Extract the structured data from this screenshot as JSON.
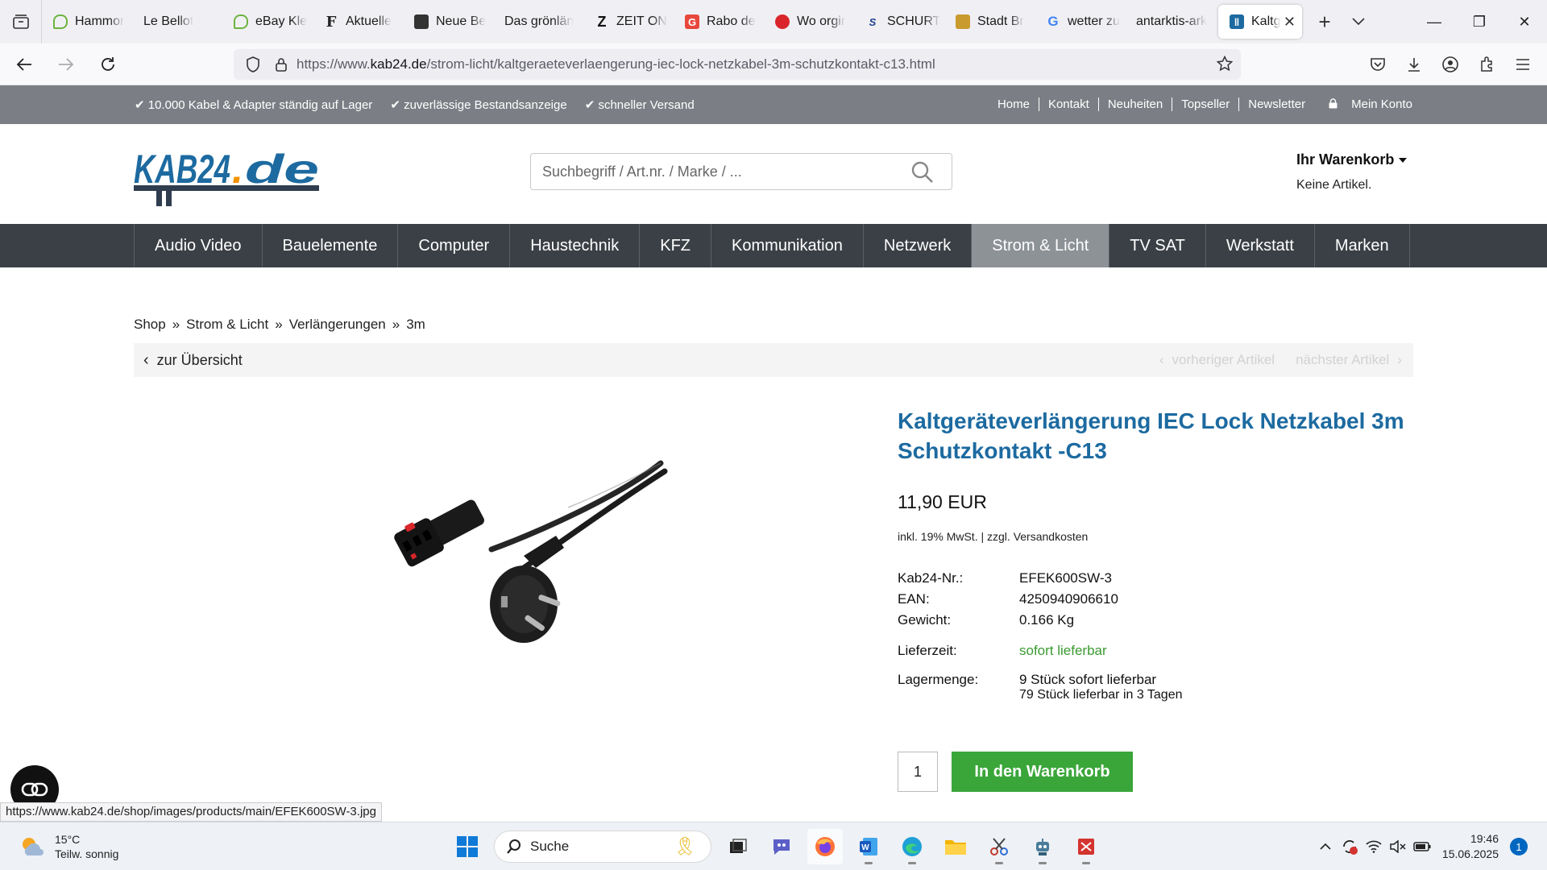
{
  "browser": {
    "tabs": [
      {
        "label": "Hammor",
        "icon": "ebay-kleinanzeigen-icon",
        "color": "#6db33f"
      },
      {
        "label": "Le Bellot",
        "icon": "blank-page-icon",
        "color": "#f0f0f4"
      },
      {
        "label": "eBay Kle",
        "icon": "ebay-kleinanzeigen-icon",
        "color": "#6db33f"
      },
      {
        "label": "Aktuelle",
        "icon": "faz-icon",
        "color": "#222222"
      },
      {
        "label": "Neue Be",
        "icon": "news-icon",
        "color": "#333333"
      },
      {
        "label": "Das grönlän",
        "icon": "blank-page-icon",
        "color": "#f0f0f4"
      },
      {
        "label": "ZEIT ON",
        "icon": "zeit-icon",
        "color": "#111111"
      },
      {
        "label": "Rabo de",
        "icon": "rabo-icon",
        "color": "#e8473c"
      },
      {
        "label": "Wo orgir",
        "icon": "web-icon",
        "color": "#d9252a"
      },
      {
        "label": "SCHURT",
        "icon": "schurter-icon",
        "color": "#1f3f8f"
      },
      {
        "label": "Stadt Br",
        "icon": "city-crest-icon",
        "color": "#c99a2e"
      },
      {
        "label": "wetter zu",
        "icon": "google-icon",
        "color": "#4285f4"
      },
      {
        "label": "antarktis-ark",
        "icon": "blank-page-icon",
        "color": "#f0f0f4"
      }
    ],
    "active_tab": {
      "label": "Kaltg",
      "icon": "kab24-icon",
      "color": "#1c6aa0"
    },
    "url_prefix": "https://www.",
    "url_domain": "kab24.de",
    "url_path": "/strom-licht/kaltgeraeteverlaengerung-iec-lock-netzkabel-3m-schutzkontakt-c13.html"
  },
  "site": {
    "usps": [
      "10.000 Kabel & Adapter ständig auf Lager",
      "zuverlässige Bestandsanzeige",
      "schneller Versand"
    ],
    "toplinks": [
      "Home",
      "Kontakt",
      "Neuheiten",
      "Topseller",
      "Newsletter"
    ],
    "account": "Mein Konto",
    "logo_text": "KAB24.de",
    "search_placeholder": "Suchbegriff / Art.nr. / Marke / ...",
    "cart_title": "Ihr Warenkorb",
    "cart_sub": "Keine Artikel.",
    "categories": [
      "Audio Video",
      "Bauelemente",
      "Computer",
      "Haustechnik",
      "KFZ",
      "Kommunikation",
      "Netzwerk",
      "Strom & Licht",
      "TV SAT",
      "Werkstatt",
      "Marken"
    ],
    "active_category": "Strom & Licht",
    "breadcrumb": [
      "Shop",
      "Strom & Licht",
      "Verlängerungen",
      "3m"
    ],
    "back_label": "zur Übersicht",
    "prev_label": "vorheriger Artikel",
    "next_label": "nächster Artikel",
    "brand_color": "#1c6aa0",
    "accent_orange": "#f39200"
  },
  "product": {
    "title": "Kaltgeräteverlängerung IEC Lock Netzkabel 3m Schutzkontakt -C13",
    "price": "11,90 EUR",
    "tax": "inkl. 19% MwSt.",
    "shipping": "zzgl. Versandkosten",
    "specs": [
      {
        "k": "Kab24-Nr.:",
        "v": "EFEK600SW-3"
      },
      {
        "k": "EAN:",
        "v": "4250940906610"
      },
      {
        "k": "Gewicht:",
        "v": "0.166 Kg"
      }
    ],
    "delivery_label": "Lieferzeit:",
    "delivery_value": "sofort lieferbar",
    "stock_label": "Lagermenge:",
    "stock_line1": "9 Stück sofort lieferbar",
    "stock_line2": "79 Stück lieferbar in 3 Tagen",
    "qty": "1",
    "add_to_cart": "In den Warenkorb",
    "status_url": "https://www.kab24.de/shop/images/products/main/EFEK600SW-3.jpg"
  },
  "taskbar": {
    "temp": "15°C",
    "weather": "Teilw. sonnig",
    "search": "Suche",
    "time": "19:46",
    "date": "15.06.2025",
    "notifications": "1"
  }
}
